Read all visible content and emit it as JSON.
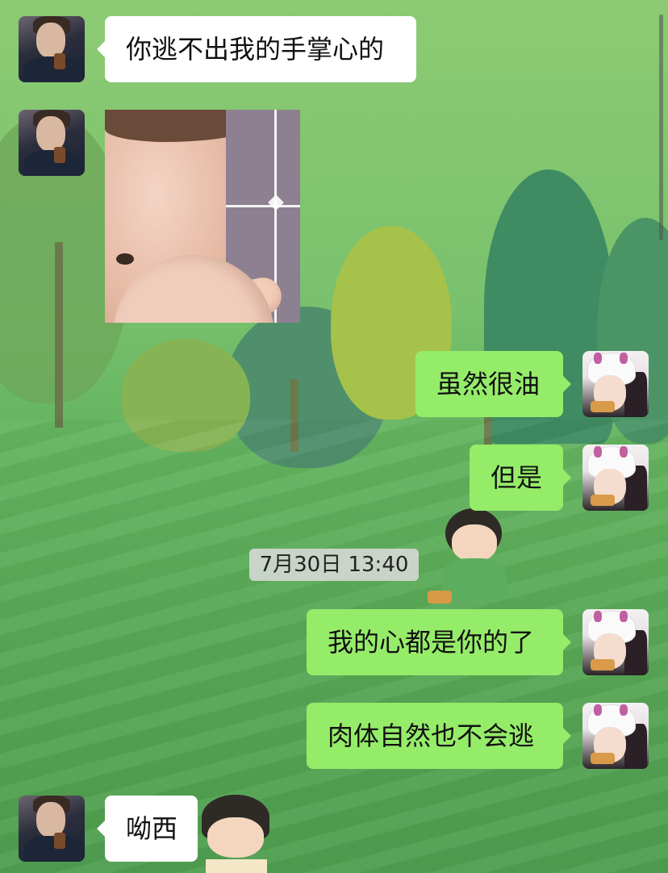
{
  "messages": [
    {
      "side": "left",
      "type": "text",
      "text": "你逃不出我的手掌心的"
    },
    {
      "side": "left",
      "type": "image",
      "alt": ""
    },
    {
      "side": "right",
      "type": "text",
      "text": "虽然很油"
    },
    {
      "side": "right",
      "type": "text",
      "text": "但是"
    },
    {
      "side": "right",
      "type": "text",
      "text": "我的心都是你的了"
    },
    {
      "side": "right",
      "type": "text",
      "text": "肉体自然也不会逃"
    },
    {
      "side": "left",
      "type": "text",
      "text": "呦西"
    }
  ],
  "timestamp": "7月30日 13:40",
  "colors": {
    "bubble_left": "#ffffff",
    "bubble_right": "#95ec69",
    "timestamp_bg": "#dcdcdc"
  }
}
